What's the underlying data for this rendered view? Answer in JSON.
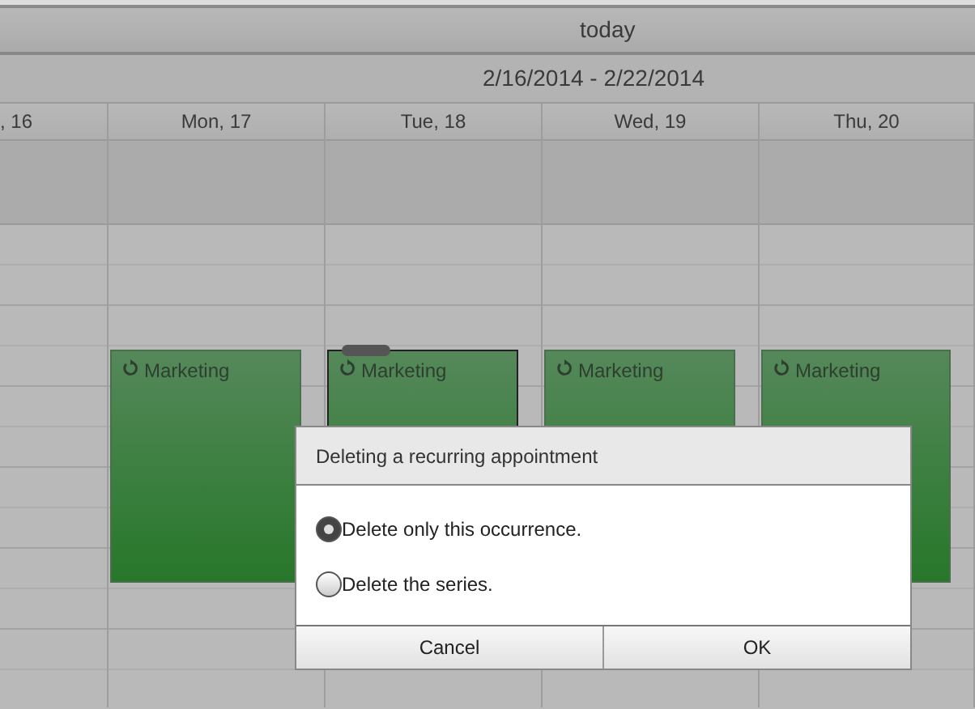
{
  "toolbar": {
    "today_button": "today"
  },
  "date_range": "2/16/2014 - 2/22/2014",
  "days": [
    {
      "label": ", 16"
    },
    {
      "label": "Mon, 17",
      "appointments": [
        {
          "title": "Marketing",
          "recurring": true,
          "selected": false
        }
      ]
    },
    {
      "label": "Tue, 18",
      "appointments": [
        {
          "title": "Marketing",
          "recurring": true,
          "selected": true
        }
      ]
    },
    {
      "label": "Wed, 19",
      "appointments": [
        {
          "title": "Marketing",
          "recurring": true,
          "selected": false
        }
      ]
    },
    {
      "label": "Thu, 20",
      "appointments": [
        {
          "title": "Marketing",
          "recurring": true,
          "selected": false
        }
      ]
    }
  ],
  "dialog": {
    "title": "Deleting a recurring appointment",
    "options": [
      {
        "label": "Delete only this occurrence.",
        "selected": true
      },
      {
        "label": "Delete the series.",
        "selected": false
      }
    ],
    "buttons": [
      "Cancel",
      "OK"
    ]
  }
}
